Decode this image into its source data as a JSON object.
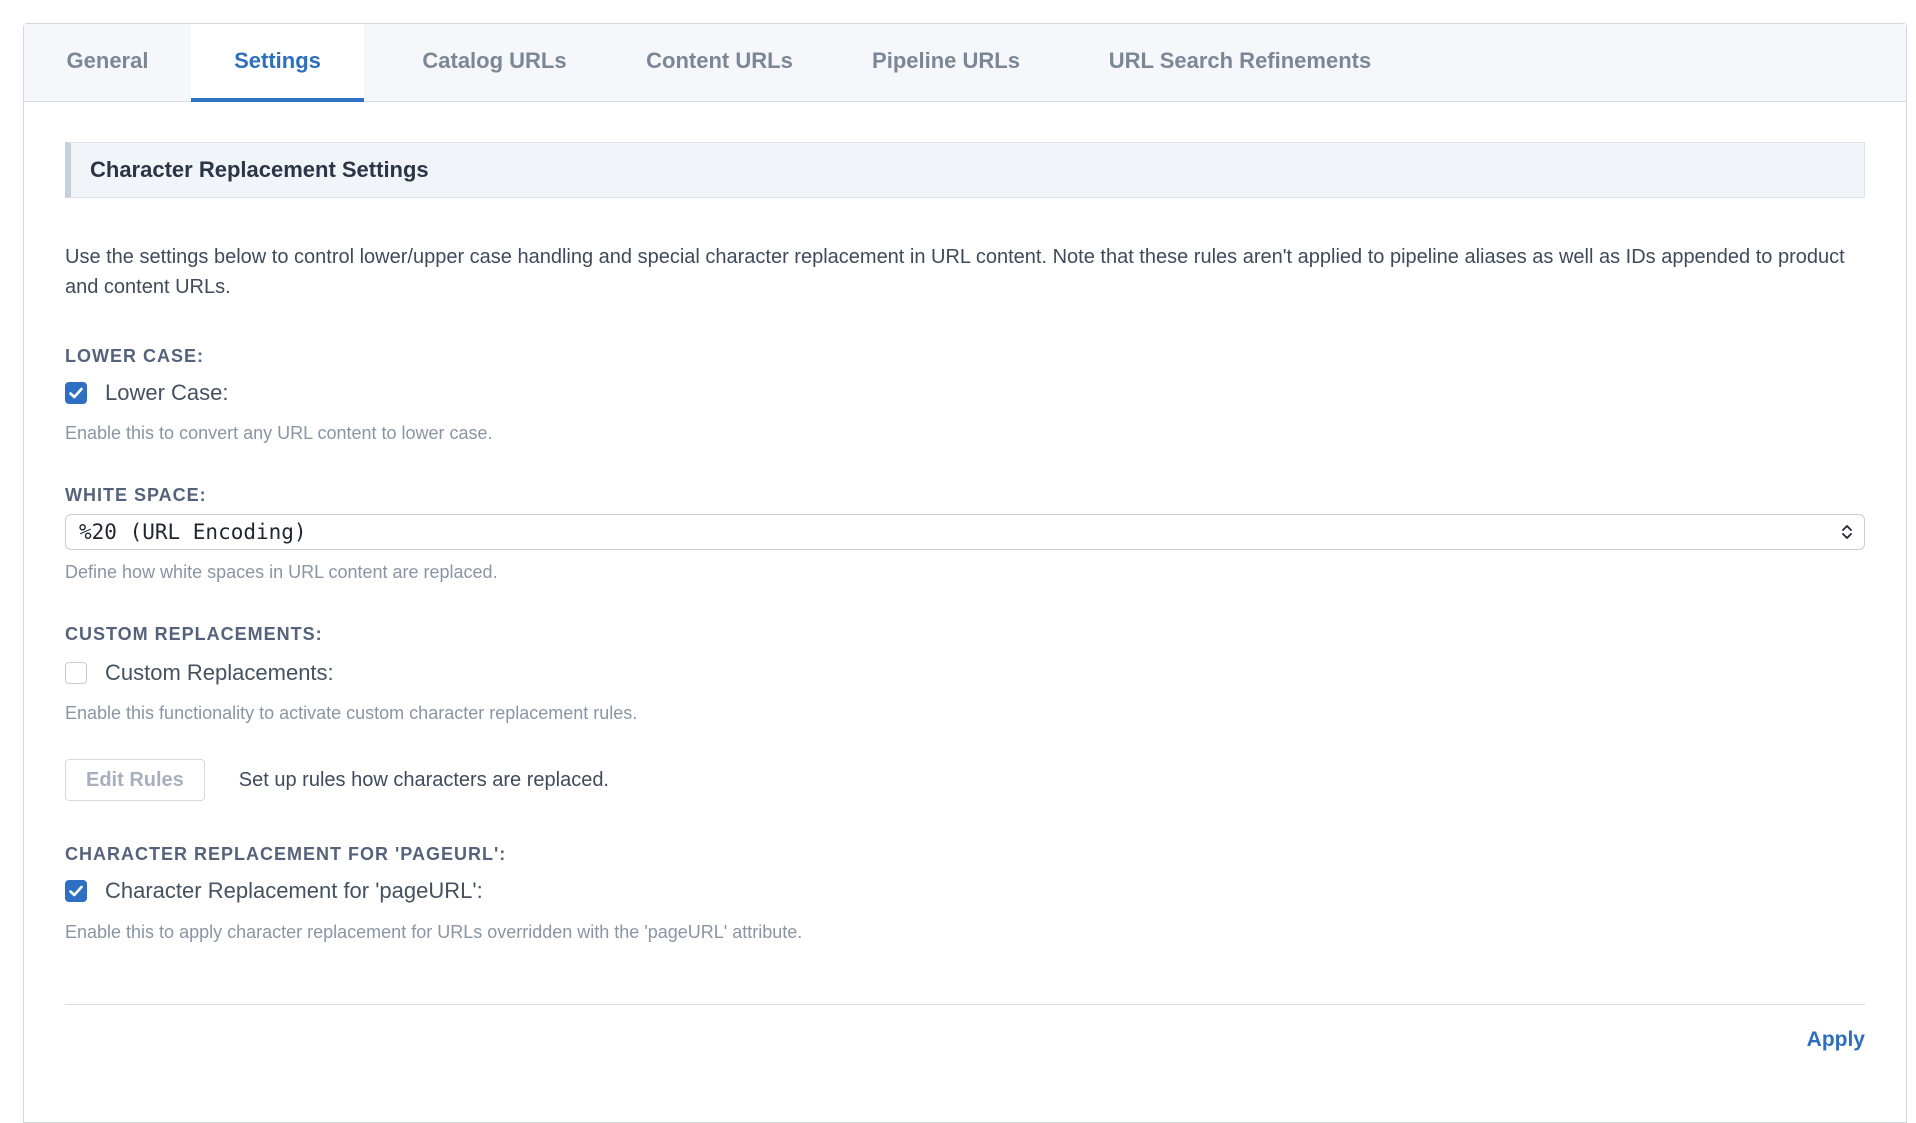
{
  "tabs": [
    {
      "label": "General",
      "active": false
    },
    {
      "label": "Settings",
      "active": true
    },
    {
      "label": "Catalog URLs",
      "active": false
    },
    {
      "label": "Content URLs",
      "active": false
    },
    {
      "label": "Pipeline URLs",
      "active": false
    },
    {
      "label": "URL Search Refinements",
      "active": false
    }
  ],
  "section": {
    "title": "Character Replacement Settings",
    "intro": "Use the settings below to control lower/upper case handling and special character replacement in URL content. Note that these rules aren't applied to pipeline aliases as well as IDs appended to product and content URLs."
  },
  "lower_case": {
    "label": "Lower Case:",
    "checkbox_label": "Lower Case:",
    "checked": true,
    "help": "Enable this to convert any URL content to lower case."
  },
  "white_space": {
    "label": "White Space:",
    "selected": "%20 (URL Encoding)",
    "help": "Define how white spaces in URL content are replaced."
  },
  "custom_replacements": {
    "label": "Custom Replacements:",
    "checkbox_label": "Custom Replacements:",
    "checked": false,
    "help": "Enable this functionality to activate custom character replacement rules."
  },
  "edit_rules": {
    "button_label": "Edit Rules",
    "description": "Set up rules how characters are replaced."
  },
  "page_url": {
    "label": "Character Replacement for 'pageURL':",
    "checkbox_label": "Character Replacement for 'pageURL':",
    "checked": true,
    "help": "Enable this to apply character replacement for URLs overridden with the 'pageURL' attribute."
  },
  "footer": {
    "apply_label": "Apply"
  },
  "colors": {
    "accent": "#2f72c2",
    "label": "#55627a",
    "help": "#8a95a3"
  }
}
